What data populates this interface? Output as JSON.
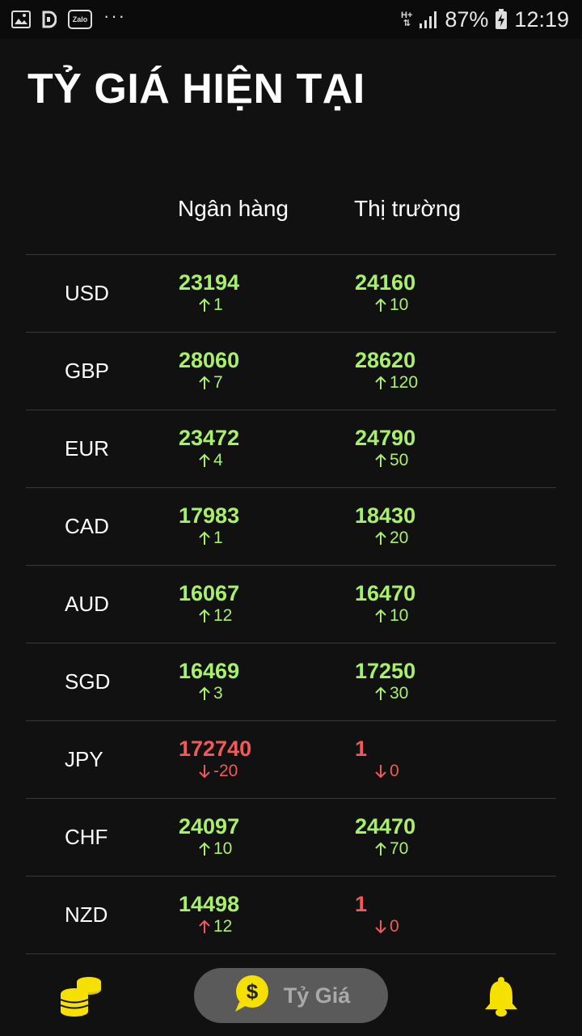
{
  "statusbar": {
    "icons": [
      "gallery-icon",
      "d-app-icon",
      "zalo-icon",
      "more-dots-icon"
    ],
    "zalo_label": "Zalo",
    "network": "H+",
    "battery": "87%",
    "time": "12:19"
  },
  "page": {
    "title": "TỶ GIÁ HIỆN TẠI"
  },
  "columns": {
    "bank": "Ngân hàng",
    "market": "Thị trường"
  },
  "rates": [
    {
      "code": "USD",
      "bank": "23194",
      "bank_change": "1",
      "market": "24160",
      "market_change": "10"
    },
    {
      "code": "GBP",
      "bank": "28060",
      "bank_change": "7",
      "market": "28620",
      "market_change": "120"
    },
    {
      "code": "EUR",
      "bank": "23472",
      "bank_change": "4",
      "market": "24790",
      "market_change": "50"
    },
    {
      "code": "CAD",
      "bank": "17983",
      "bank_change": "1",
      "market": "18430",
      "market_change": "20"
    },
    {
      "code": "AUD",
      "bank": "16067",
      "bank_change": "12",
      "market": "16470",
      "market_change": "10"
    },
    {
      "code": "SGD",
      "bank": "16469",
      "bank_change": "3",
      "market": "17250",
      "market_change": "30"
    },
    {
      "code": "JPY",
      "bank": "172740",
      "bank_change": "-20",
      "market": "1",
      "market_change": "0"
    },
    {
      "code": "CHF",
      "bank": "24097",
      "bank_change": "10",
      "market": "24470",
      "market_change": "70"
    },
    {
      "code": "NZD",
      "bank": "14498",
      "bank_change": "12",
      "market": "1",
      "market_change": "0"
    }
  ],
  "colors": {
    "up": "#a8f06a",
    "down": "#f05a5a",
    "accent": "#f5e000",
    "pill": "#5a5a5a"
  },
  "bottom_nav": {
    "coins_icon": "coins-icon",
    "active_label": "Tỷ Giá",
    "active_icon": "dollar-chat-icon",
    "bell_icon": "bell-icon"
  }
}
